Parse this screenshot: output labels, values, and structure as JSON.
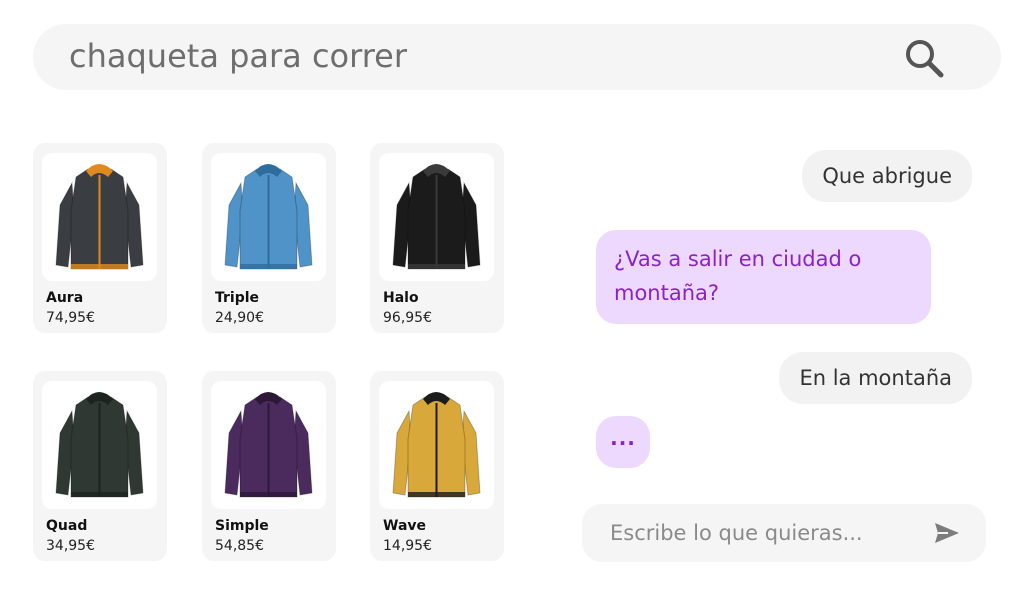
{
  "search": {
    "query": "chaqueta para correr",
    "icon": "search-icon"
  },
  "products": [
    {
      "name": "Aura",
      "price": "74,95€",
      "jacket_color": "#3a3d42",
      "accent_color": "#e08a1e"
    },
    {
      "name": "Triple",
      "price": "24,90€",
      "jacket_color": "#4f93c8",
      "accent_color": "#2f6d9e"
    },
    {
      "name": "Halo",
      "price": "96,95€",
      "jacket_color": "#1b1b1b",
      "accent_color": "#3a3a3a"
    },
    {
      "name": "Quad",
      "price": "34,95€",
      "jacket_color": "#2f3833",
      "accent_color": "#1d2420"
    },
    {
      "name": "Simple",
      "price": "54,85€",
      "jacket_color": "#4b2a5e",
      "accent_color": "#2d1838"
    },
    {
      "name": "Wave",
      "price": "14,95€",
      "jacket_color": "#d9a83a",
      "accent_color": "#1c1c1c"
    }
  ],
  "chat": {
    "messages": [
      {
        "role": "user",
        "text": "Que abrigue"
      },
      {
        "role": "assistant",
        "text": "¿Vas a salir en ciudad o montaña?"
      },
      {
        "role": "user",
        "text": "En la montaña"
      },
      {
        "role": "assistant",
        "text": "..."
      }
    ],
    "input_placeholder": "Escribe lo que quieras...",
    "send_icon": "send-icon"
  },
  "colors": {
    "accent": "#8a22c9",
    "assistant_bubble": "#ecd9fd",
    "surface": "#f5f5f5"
  }
}
